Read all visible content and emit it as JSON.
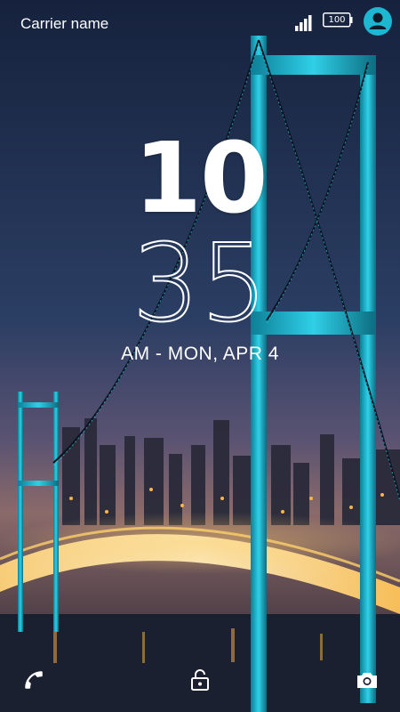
{
  "status_bar": {
    "carrier": "Carrier name",
    "battery_level": "100",
    "signal_icon": "signal-bars-icon",
    "avatar_color": "#1db7d1"
  },
  "clock": {
    "hour": "10",
    "minute": "35",
    "date": "AM - MON, APR 4"
  },
  "shortcuts": {
    "phone_icon": "phone-icon",
    "unlock_icon": "unlock-icon",
    "camera_icon": "camera-icon"
  },
  "colors": {
    "accent": "#2fd0e8",
    "sky_top": "#16223d",
    "city_lights": "#ffb547"
  }
}
